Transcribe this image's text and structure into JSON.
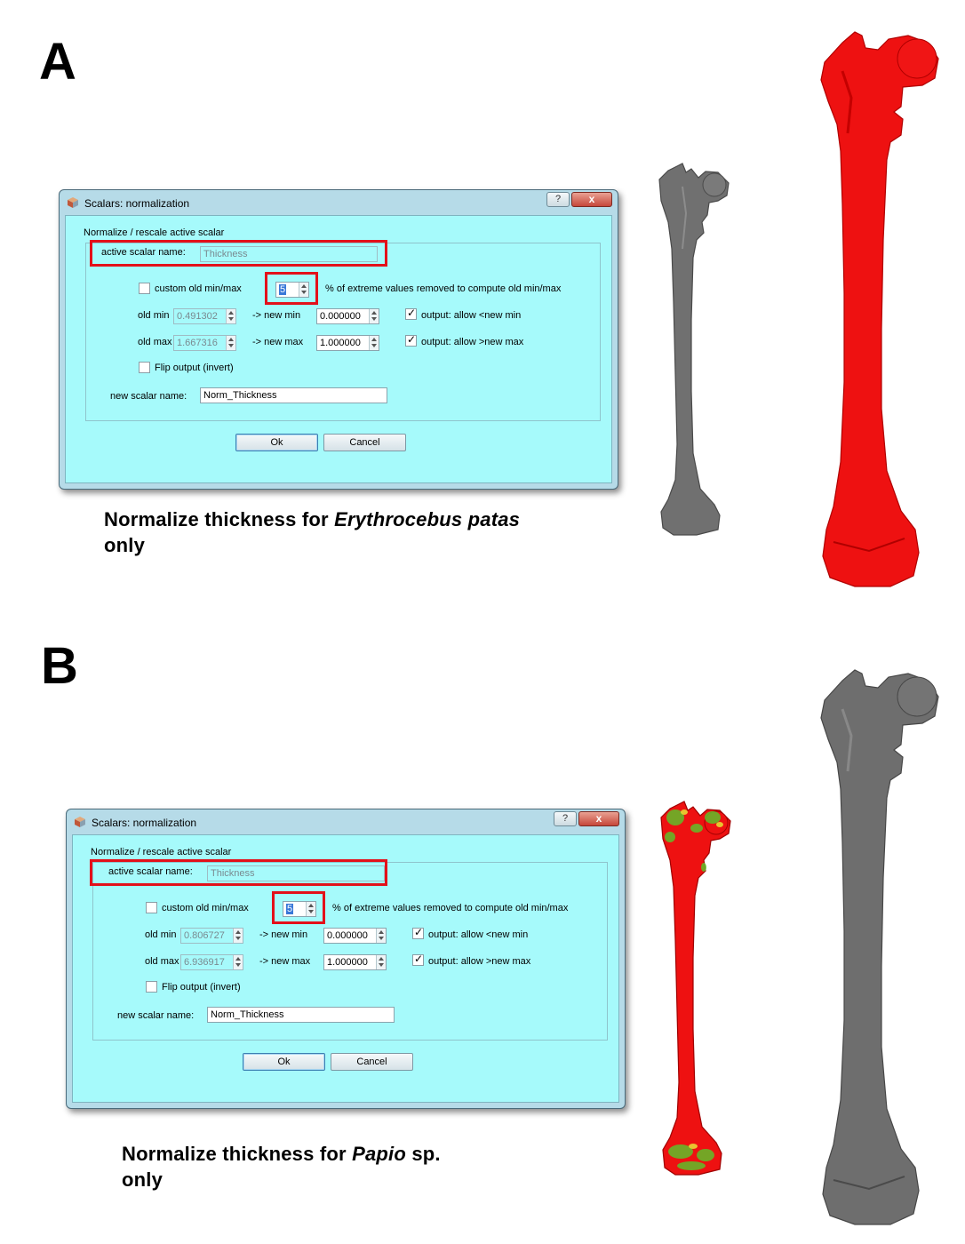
{
  "panels": [
    {
      "letter": "A",
      "dialog": {
        "title": "Scalars: normalization",
        "help_button": "?",
        "close_button": "x",
        "section_label": "Normalize / rescale active scalar",
        "active_scalar_label": "active scalar name:",
        "active_scalar_value": "Thickness",
        "custom_minmax_label": "custom old min/max",
        "custom_minmax_checked": false,
        "percent_value": "5",
        "percent_label": "% of extreme values removed to compute old min/max",
        "old_min_label": "old min",
        "old_min_value": "0.491302",
        "new_min_label": "-> new min",
        "new_min_value": "0.000000",
        "allow_below_label": "output: allow <new min",
        "allow_below_checked": true,
        "old_max_label": "old max",
        "old_max_value": "1.667316",
        "new_max_label": "-> new max",
        "new_max_value": "1.000000",
        "allow_above_label": "output: allow >new max",
        "allow_above_checked": true,
        "flip_label": "Flip output (invert)",
        "flip_checked": false,
        "new_scalar_label": "new scalar name:",
        "new_scalar_value": "Norm_Thickness",
        "ok_label": "Ok",
        "cancel_label": "Cancel"
      },
      "caption": {
        "prefix": "Normalize thickness for ",
        "species": "Erythrocebus patas",
        "suffix": "",
        "line2": "only"
      },
      "small_bone_color": "#6e6e6e",
      "large_bone_color": "#ee1111"
    },
    {
      "letter": "B",
      "dialog": {
        "title": "Scalars: normalization",
        "help_button": "?",
        "close_button": "x",
        "section_label": "Normalize / rescale active scalar",
        "active_scalar_label": "active scalar name:",
        "active_scalar_value": "Thickness",
        "custom_minmax_label": "custom old min/max",
        "custom_minmax_checked": false,
        "percent_value": "5",
        "percent_label": "% of extreme values removed to compute old min/max",
        "old_min_label": "old min",
        "old_min_value": "0.806727",
        "new_min_label": "-> new min",
        "new_min_value": "0.000000",
        "allow_below_label": "output: allow <new min",
        "allow_below_checked": true,
        "old_max_label": "old max",
        "old_max_value": "6.936917",
        "new_max_label": "-> new max",
        "new_max_value": "1.000000",
        "allow_above_label": "output: allow >new max",
        "allow_above_checked": true,
        "flip_label": "Flip output (invert)",
        "flip_checked": false,
        "new_scalar_label": "new scalar name:",
        "new_scalar_value": "Norm_Thickness",
        "ok_label": "Ok",
        "cancel_label": "Cancel"
      },
      "caption": {
        "prefix": "Normalize thickness for ",
        "species": "Papio",
        "suffix": " sp.",
        "line2": "only"
      },
      "small_bone_color": "#ee1111",
      "small_bone_highlight": "#5fbf2a",
      "large_bone_color": "#6e6e6e"
    }
  ]
}
